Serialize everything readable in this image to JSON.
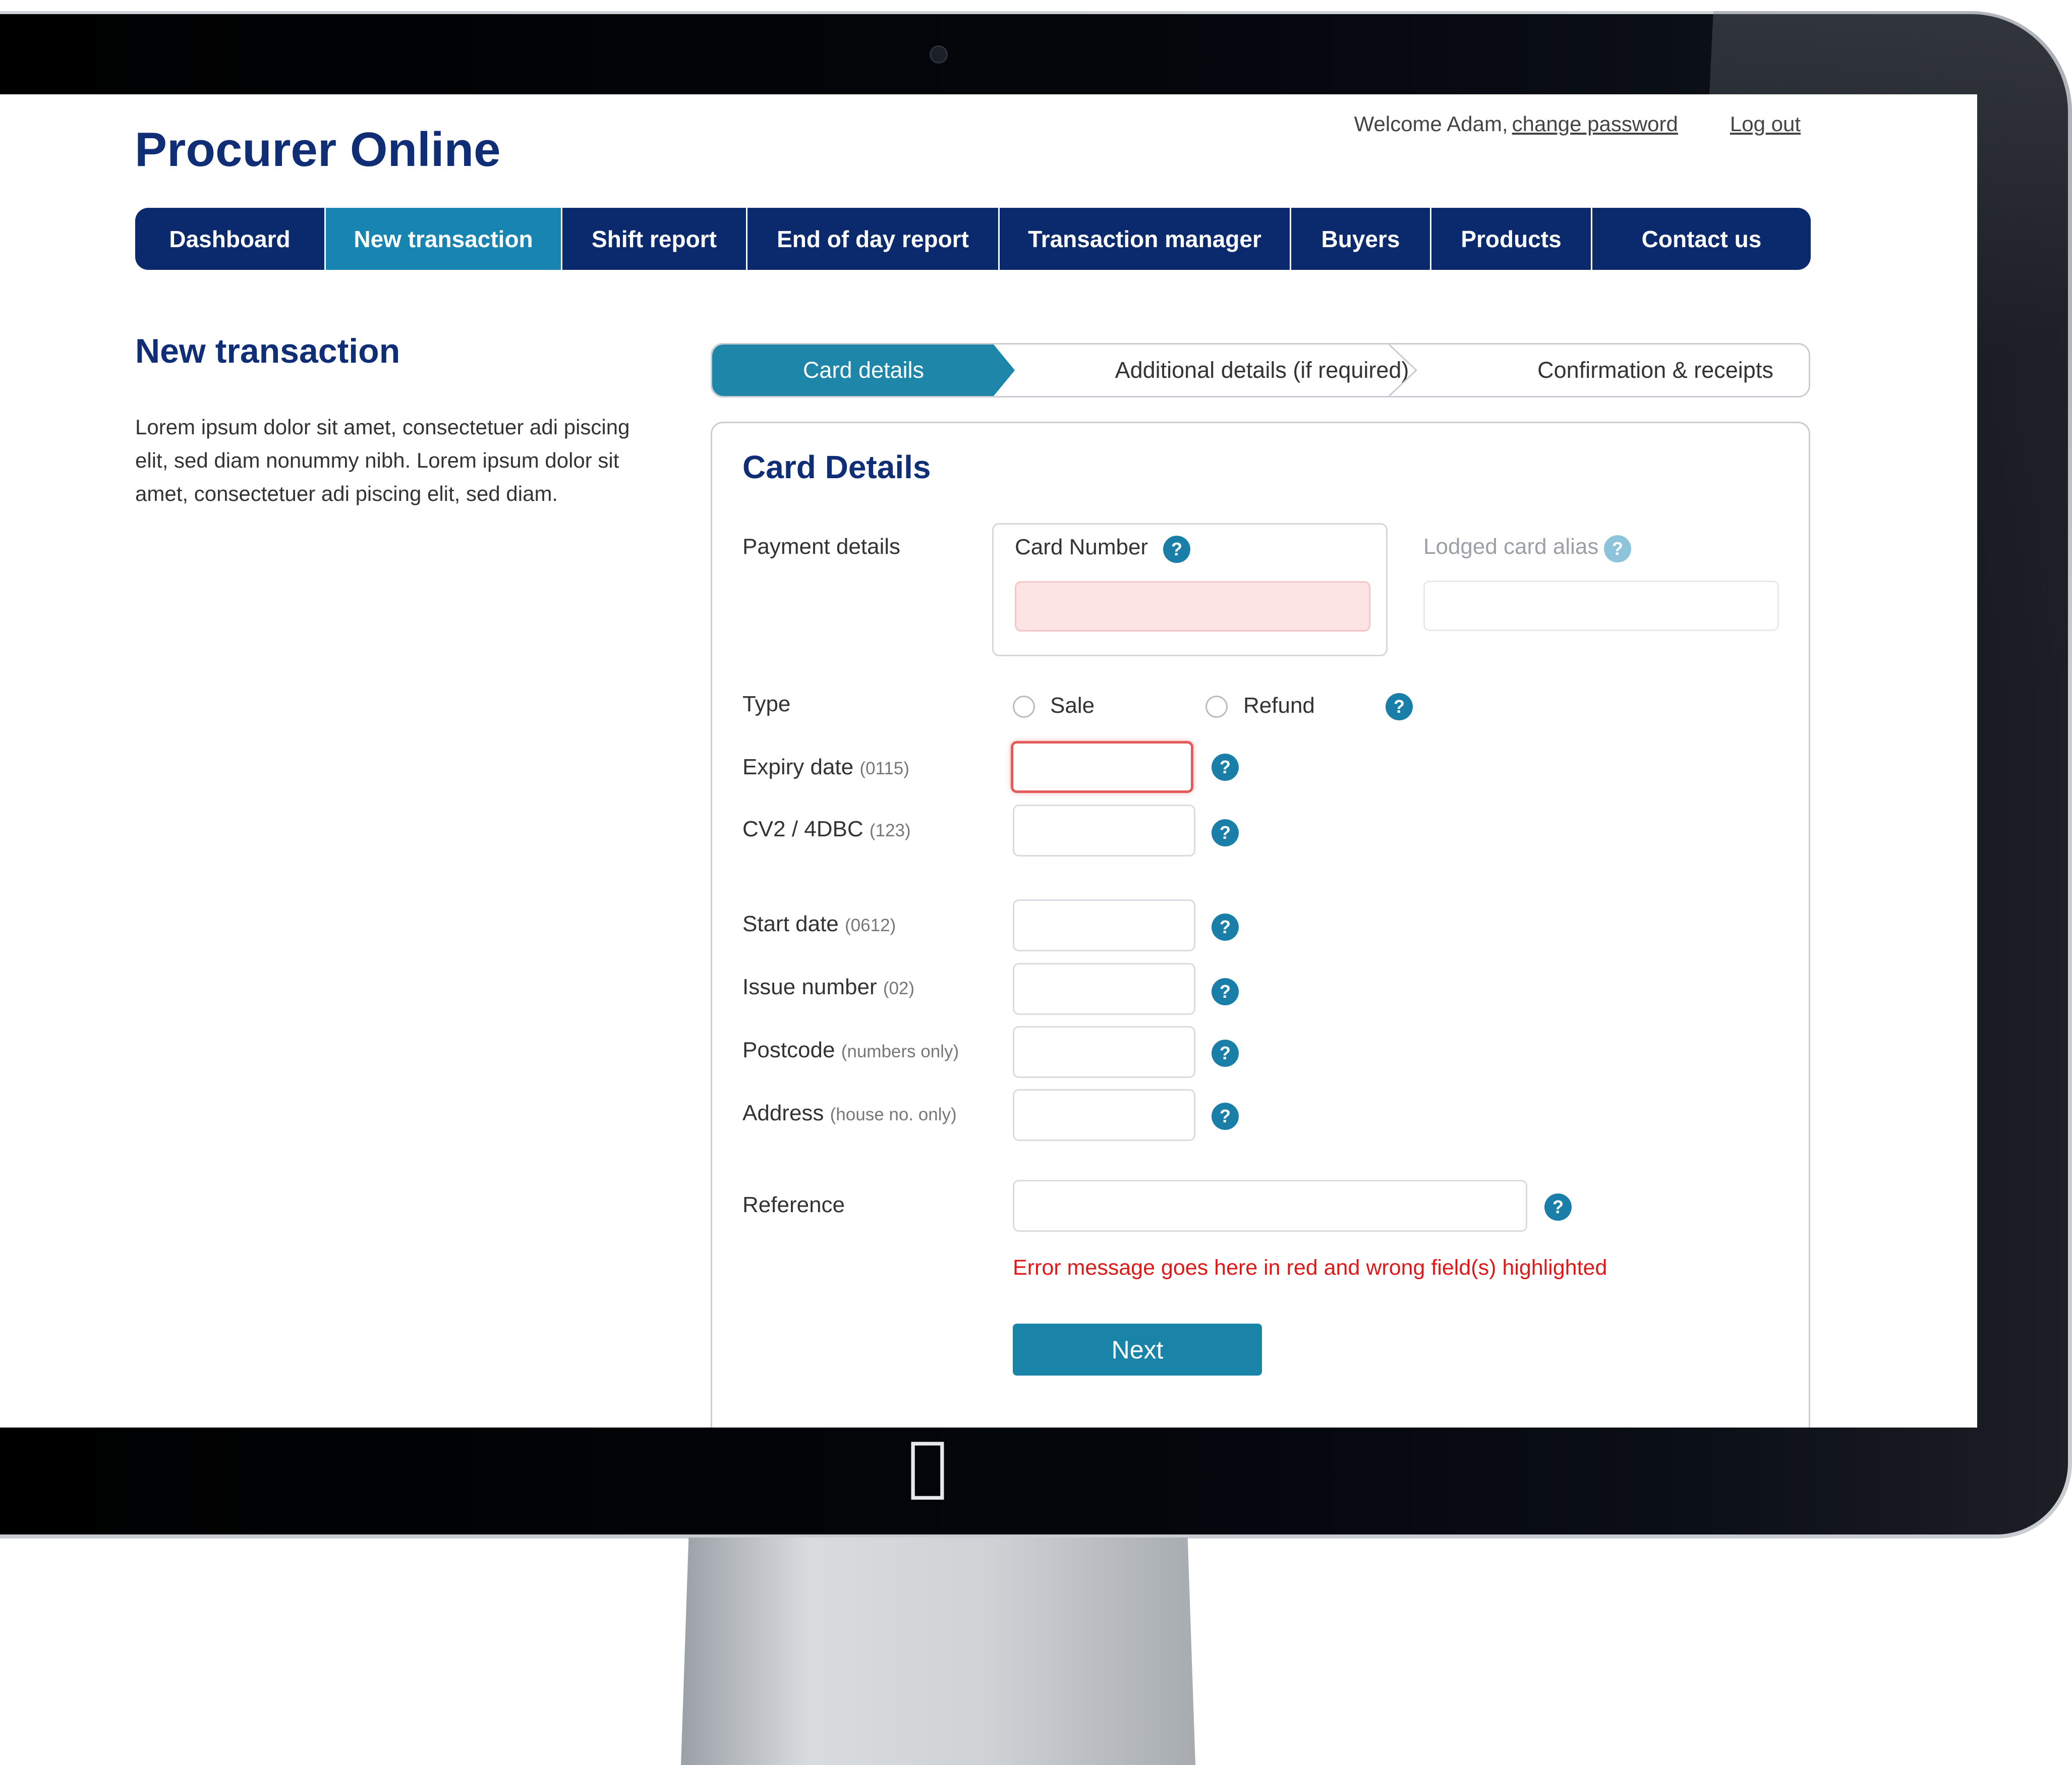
{
  "app": {
    "title": "Procurer Online"
  },
  "header": {
    "welcome": "Welcome Adam,",
    "change_password": "change password",
    "logout": "Log out"
  },
  "nav": {
    "items": [
      {
        "label": "Dashboard"
      },
      {
        "label": "New transaction",
        "active": true
      },
      {
        "label": "Shift report"
      },
      {
        "label": "End of day report"
      },
      {
        "label": "Transaction manager"
      },
      {
        "label": "Buyers"
      },
      {
        "label": "Products"
      },
      {
        "label": "Contact us"
      }
    ]
  },
  "page": {
    "title": "New transaction",
    "intro": "Lorem ipsum dolor sit amet, consectetuer adi piscing elit, sed diam nonummy nibh. Lorem ipsum dolor sit amet, consectetuer adi piscing elit, sed diam."
  },
  "steps": [
    {
      "label": "Card details",
      "active": true
    },
    {
      "label": "Additional details (if required)"
    },
    {
      "label": "Confirmation & receipts"
    }
  ],
  "form": {
    "title": "Card Details",
    "payment_details_label": "Payment details",
    "card_number_label": "Card Number",
    "card_number_value": "",
    "lodged_alias_label": "Lodged card alias",
    "lodged_alias_value": "",
    "type_label": "Type",
    "type_options": [
      "Sale",
      "Refund"
    ],
    "type_selected": null,
    "expiry": {
      "label": "Expiry date",
      "hint": "(0115)",
      "value": "",
      "error": true
    },
    "cv2": {
      "label": "CV2 / 4DBC",
      "hint": "(123)",
      "value": ""
    },
    "start_date": {
      "label": "Start date",
      "hint": "(0612)",
      "value": ""
    },
    "issue_number": {
      "label": "Issue number",
      "hint": "(02)",
      "value": ""
    },
    "postcode": {
      "label": "Postcode",
      "hint": "(numbers only)",
      "value": ""
    },
    "address": {
      "label": "Address",
      "hint": "(house no. only)",
      "value": ""
    },
    "reference": {
      "label": "Reference",
      "value": ""
    },
    "help_glyph": "?",
    "error_message": "Error message goes here in red and wrong field(s) highlighted",
    "next_label": "Next"
  },
  "colors": {
    "navy": "#0b2a6e",
    "accent": "#1784b1",
    "error": "#e01818"
  },
  "icons": [
    "help-icon",
    "apple-logo-icon"
  ]
}
